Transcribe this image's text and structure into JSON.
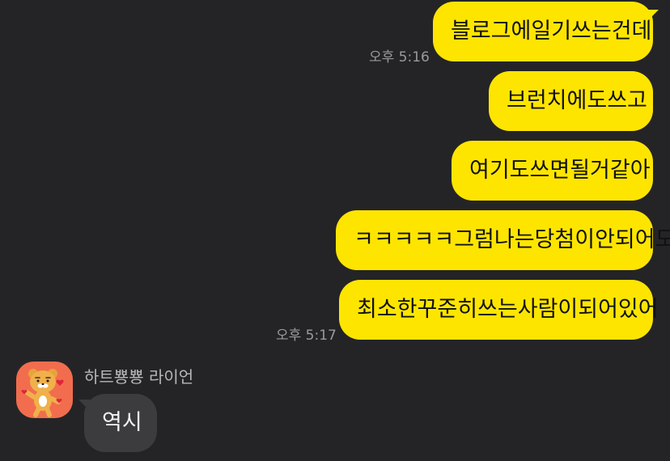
{
  "messages_sent": [
    {
      "text": "블로그에일기쓰는건데"
    },
    {
      "text": "브런치에도쓰고"
    },
    {
      "text": "여기도쓰면될거같아"
    },
    {
      "text": "ㅋㅋㅋㅋㅋ그럼나는당첨이안되어도"
    },
    {
      "text": "최소한꾸준히쓰는사람이되어있어"
    }
  ],
  "timestamps": {
    "first_group": "오후 5:16",
    "second_group": "오후 5:17"
  },
  "received": {
    "sender_name": "하트뿅뿅 라이언",
    "avatar_icon": "ryan-heart-character-icon",
    "message": "역시"
  },
  "colors": {
    "background": "#242426",
    "my_bubble": "#fee500",
    "other_bubble": "#3c3c3e",
    "avatar_bg": "#f26d4e"
  }
}
